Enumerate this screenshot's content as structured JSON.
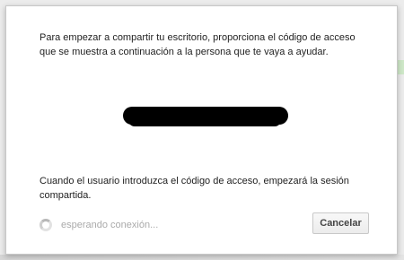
{
  "dialog": {
    "intro_text": "Para empezar a compartir tu escritorio, proporciona el código de acceso que se muestra a continuación a la persona que te vaya a ayudar.",
    "info_text": "Cuando el usuario introduzca el código de acceso, empezará la sesión compartida.",
    "status_text": "esperando conexión...",
    "cancel_label": "Cancelar",
    "status_icon": "spinner-icon",
    "code_redacted": true
  }
}
